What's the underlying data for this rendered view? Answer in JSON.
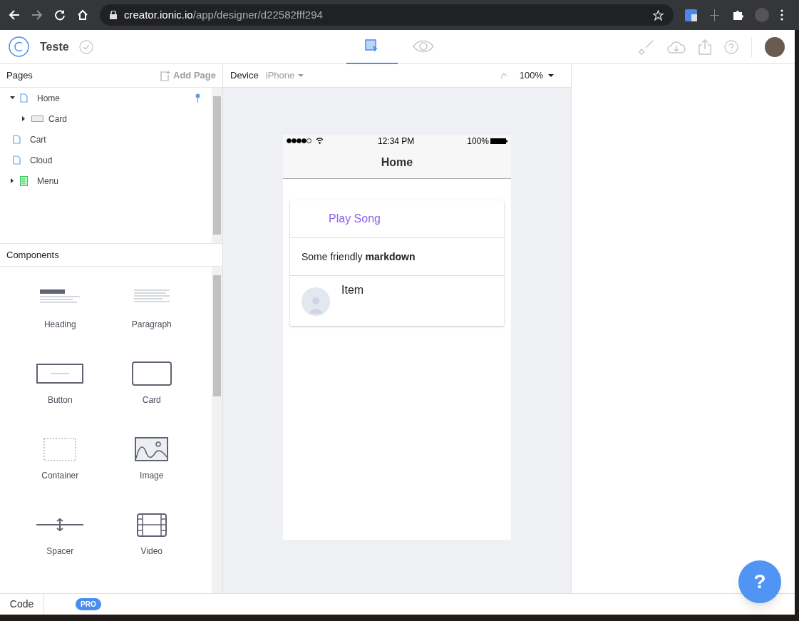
{
  "browser": {
    "url_host": "creator.ionic.io",
    "url_path": "/app/designer/d22582fff294"
  },
  "app": {
    "title": "Teste",
    "view_tabs": [
      {
        "kind": "design",
        "selected": true
      },
      {
        "kind": "preview",
        "selected": false
      }
    ]
  },
  "pages_panel": {
    "title": "Pages",
    "add_button": "Add Page",
    "tree": [
      {
        "label": "Home",
        "kind": "page",
        "expanded": true,
        "children": [
          {
            "label": "Card",
            "kind": "card",
            "expanded": false
          }
        ]
      },
      {
        "label": "Cart",
        "kind": "page"
      },
      {
        "label": "Cloud",
        "kind": "page"
      },
      {
        "label": "Menu",
        "kind": "menu",
        "expanded": false
      }
    ]
  },
  "components_panel": {
    "title": "Components",
    "items": [
      {
        "label": "Heading",
        "kind": "heading"
      },
      {
        "label": "Paragraph",
        "kind": "paragraph"
      },
      {
        "label": "Button",
        "kind": "button"
      },
      {
        "label": "Card",
        "kind": "card"
      },
      {
        "label": "Container",
        "kind": "container"
      },
      {
        "label": "Image",
        "kind": "image"
      },
      {
        "label": "Spacer",
        "kind": "spacer"
      },
      {
        "label": "Video",
        "kind": "video"
      }
    ]
  },
  "device_bar": {
    "label": "Device",
    "device": "iPhone",
    "zoom": "100%"
  },
  "phone": {
    "time": "12:34 PM",
    "battery": "100%",
    "title": "Home",
    "card_rows": [
      {
        "kind": "button",
        "text": "Play Song"
      },
      {
        "kind": "markdown",
        "text": "Some friendly **markdown**"
      },
      {
        "kind": "item",
        "text": "Item"
      }
    ]
  },
  "footer": {
    "code_tab": "Code",
    "badge": "PRO"
  },
  "help_button": "?"
}
